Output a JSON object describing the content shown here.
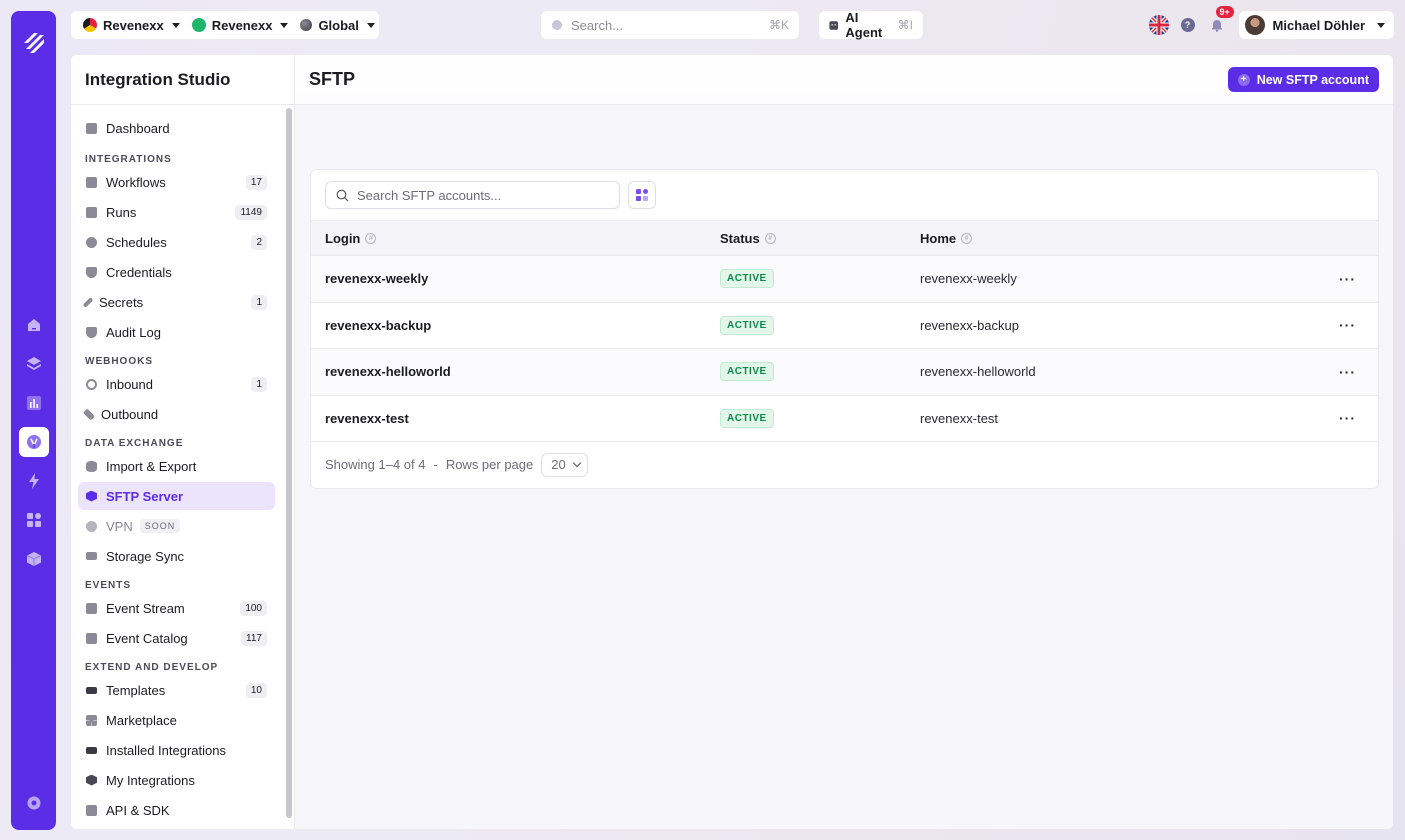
{
  "topbar": {
    "workspace1": "Revenexx",
    "workspace2": "Revenexx",
    "workspace3": "Global",
    "search_placeholder": "Search...",
    "search_shortcut": "⌘K",
    "ai_agent_label": "AI Agent",
    "ai_agent_shortcut": "⌘I",
    "notifications_count": "9+",
    "user_name": "Michael Döhler",
    "help_label": "?"
  },
  "sidebar": {
    "title": "Integration Studio",
    "dashboard": "Dashboard",
    "sections": {
      "integrations": "INTEGRATIONS",
      "webhooks": "WEBHOOKS",
      "data_exchange": "DATA EXCHANGE",
      "events": "EVENTS",
      "extend": "EXTEND AND DEVELOP"
    },
    "integrations": [
      {
        "label": "Workflows",
        "count": "17"
      },
      {
        "label": "Runs",
        "count": "1149"
      },
      {
        "label": "Schedules",
        "count": "2"
      },
      {
        "label": "Credentials",
        "count": ""
      },
      {
        "label": "Secrets",
        "count": "1"
      },
      {
        "label": "Audit Log",
        "count": ""
      }
    ],
    "webhooks": [
      {
        "label": "Inbound",
        "count": "1"
      },
      {
        "label": "Outbound",
        "count": ""
      }
    ],
    "data_exchange": [
      {
        "label": "Import & Export"
      },
      {
        "label": "SFTP Server"
      },
      {
        "label": "VPN",
        "tag": "SOON"
      },
      {
        "label": "Storage Sync"
      }
    ],
    "events": [
      {
        "label": "Event Stream",
        "count": "100"
      },
      {
        "label": "Event Catalog",
        "count": "117"
      }
    ],
    "extend": [
      {
        "label": "Templates",
        "count": "10"
      },
      {
        "label": "Marketplace"
      },
      {
        "label": "Installed Integrations"
      },
      {
        "label": "My Integrations"
      },
      {
        "label": "API & SDK"
      }
    ]
  },
  "main": {
    "title": "SFTP",
    "new_button": "New SFTP account",
    "search_placeholder": "Search SFTP accounts...",
    "columns": {
      "login": "Login",
      "status": "Status",
      "home": "Home"
    },
    "rows": [
      {
        "login": "revenexx-weekly",
        "status": "ACTIVE",
        "home": "revenexx-weekly"
      },
      {
        "login": "revenexx-backup",
        "status": "ACTIVE",
        "home": "revenexx-backup"
      },
      {
        "login": "revenexx-helloworld",
        "status": "ACTIVE",
        "home": "revenexx-helloworld"
      },
      {
        "login": "revenexx-test",
        "status": "ACTIVE",
        "home": "revenexx-test"
      }
    ],
    "row_action": "···",
    "footer": {
      "showing": "Showing 1–4 of 4",
      "separator": "-",
      "rows_label": "Rows per page",
      "rows_value": "20"
    }
  },
  "colors": {
    "accent": "#5b2de6",
    "status_active": "#0f8a4b"
  }
}
